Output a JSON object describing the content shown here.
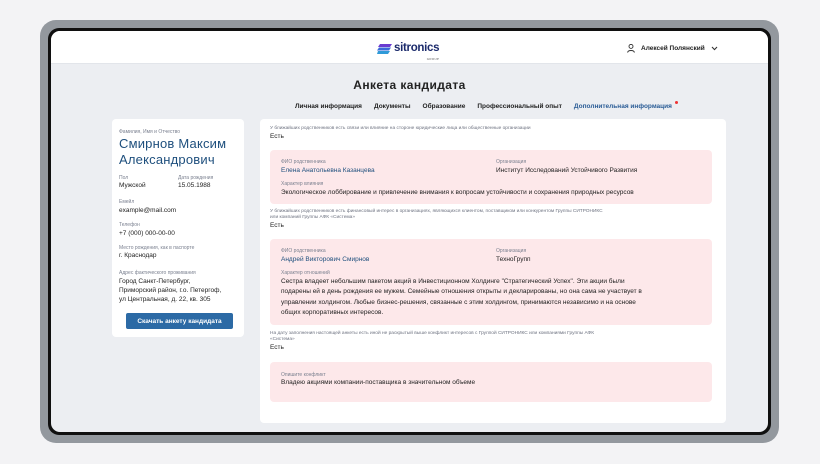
{
  "brand": {
    "name": "sitronics",
    "sub": "GROUP"
  },
  "user": {
    "name": "Алексей Полянский"
  },
  "page": {
    "title": "Анкета кандидата"
  },
  "tabs": [
    {
      "label": "Личная информация"
    },
    {
      "label": "Документы"
    },
    {
      "label": "Образование"
    },
    {
      "label": "Профессиональный опыт"
    },
    {
      "label": "Дополнительная информация",
      "active": true
    }
  ],
  "candidate": {
    "name_label": "Фамилия, Имя и Отчество",
    "name_line1": "Смирнов Максим",
    "name_line2": "Александрович",
    "gender_label": "Пол",
    "gender": "Мужской",
    "birth_label": "Дата рождения",
    "birth": "15.05.1988",
    "email_label": "Емейл",
    "email": "example@mail.com",
    "phone_label": "Телефон",
    "phone": "+7 (000) 000-00-00",
    "birthplace_label": "Место рождения, как в паспорте",
    "birthplace": "г. Краснодар",
    "address_label": "Адрес фактического проживания",
    "address_lines": [
      "Город Санкт-Петербург,",
      "Приморский район, г.о. Петергоф,",
      "ул Центральная, д. 22, кв. 305"
    ],
    "download_label": "Скачать анкету кандидата"
  },
  "sections": {
    "q1": "У ближайших родственников есть связи или влияние на стороне юридические лица или общественные организации",
    "a1": "Есть",
    "rel1": {
      "fio_label": "ФИО родственника",
      "fio": "Елена Анатольевна Казанцева",
      "org_label": "Организация",
      "org": "Институт Исследований Устойчивого Развития",
      "infl_label": "Характер влияния",
      "infl": "Экологическое лоббирование и привлечение внимания к вопросам устойчивости и сохранения природных ресурсов"
    },
    "q2_lines": [
      "У ближайших родственников есть финансовый интерес в организациях, являющихся клиентом, поставщиком или конкурентом Группы СИТРОНИКС",
      "или компаний Группы АФК «Система»"
    ],
    "a2": "Есть",
    "rel2": {
      "fio_label": "ФИО родственника",
      "fio": "Андрей Викторович Смирнов",
      "org_label": "Организация",
      "org": "ТехноГрупп",
      "rel_label": "Характер отношений",
      "rel_lines": [
        "Сестра владеет небольшим пакетом акций в Инвестиционном Холдинге \"Стратегический Успех\". Эти акции были",
        "подарены ей в день рождения ее мужем. Семейные отношения открыты и декларированы, но она сама не участвует в",
        "управлении холдингом. Любые бизнес-решения, связанные с этим холдингом, принимаются независимо и на основе",
        "общих корпоративных интересов."
      ]
    },
    "q3_lines": [
      "На дату заполнения настоящей анкеты есть иной не раскрытый выше конфликт интересов с Группой СИТРОНИКС или компаниями Группы АФК",
      "«Система»"
    ],
    "a3": "Есть",
    "conflict": {
      "label": "Опишите конфликт",
      "text": "Владею акциями компании-поставщика в значительном объеме"
    }
  }
}
